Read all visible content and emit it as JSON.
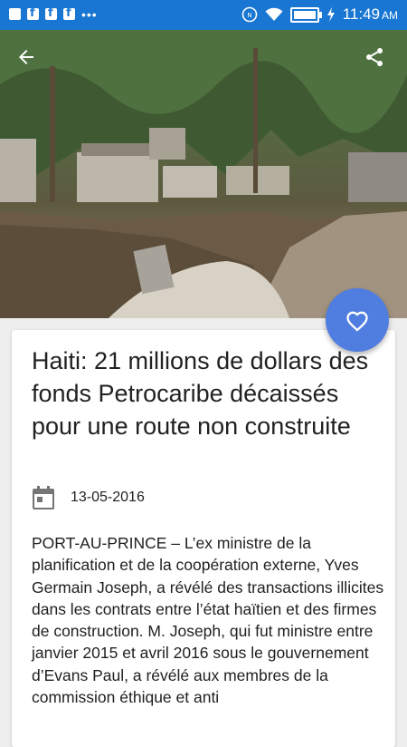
{
  "status_bar": {
    "time": "11:49",
    "ampm": "AM",
    "notification_icons": [
      "image-icon",
      "facebook-icon",
      "facebook-icon",
      "facebook-icon",
      "more-dots-icon"
    ],
    "system_icons": [
      "nfc-icon",
      "wifi-icon",
      "battery-icon",
      "charging-bolt-icon"
    ]
  },
  "header": {
    "back_icon": "arrow-back-icon",
    "share_icon": "share-icon",
    "favorite_icon": "heart-outline-icon",
    "accent_color": "#1976d2",
    "fab_color": "#4f7de0"
  },
  "article": {
    "title": "Haiti: 21 millions de dollars des fonds Petrocaribe décaissés pour une route non construite",
    "date": "13-05-2016",
    "date_icon": "calendar-icon",
    "body": "PORT-AU-PRINCE – L’ex ministre de la planification et de la coopération externe, Yves Germain Joseph, a révélé des transactions illicites dans les contrats entre l’état haïtien et des firmes de construction. M. Joseph, qui fut ministre entre janvier 2015 et avril 2016 sous le gouvernement d’Evans Paul, a révélé aux membres de la commission éthique et anti"
  }
}
